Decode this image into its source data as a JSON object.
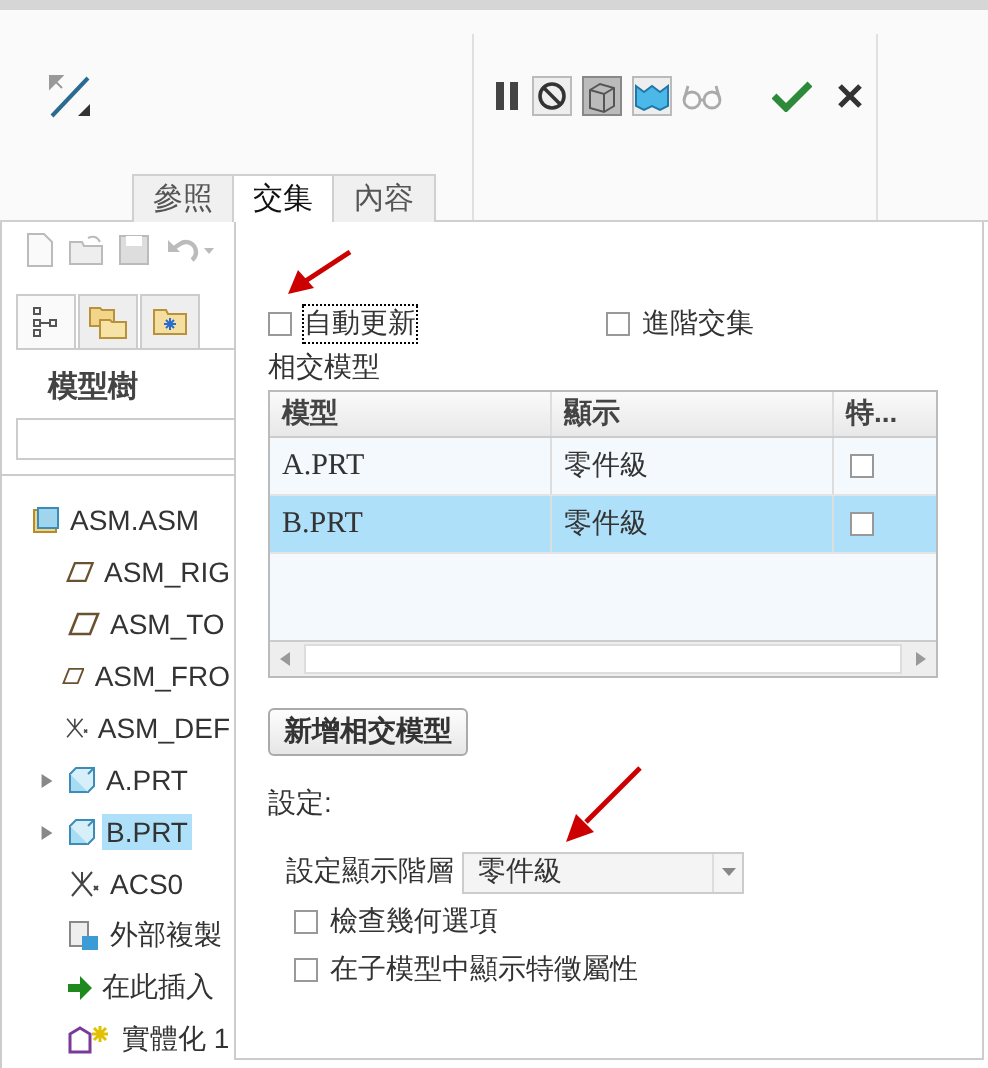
{
  "ribbon": {
    "tabs": [
      {
        "label": "參照",
        "selected": false
      },
      {
        "label": "交集",
        "selected": true
      },
      {
        "label": "內容",
        "selected": false
      }
    ]
  },
  "sidebar": {
    "tabs": [
      {
        "kind": "tree",
        "selected": true
      },
      {
        "kind": "folders",
        "selected": false
      },
      {
        "kind": "favorites",
        "selected": false
      }
    ],
    "title": "模型樹",
    "tree": [
      {
        "label": "ASM.ASM",
        "kind": "assembly",
        "selected": false,
        "children": [
          {
            "label": "ASM_RIG",
            "kind": "plane",
            "selected": false
          },
          {
            "label": "ASM_TO",
            "kind": "plane",
            "selected": false
          },
          {
            "label": "ASM_FRO",
            "kind": "plane",
            "selected": false
          },
          {
            "label": "ASM_DEF",
            "kind": "csys",
            "selected": false
          },
          {
            "label": "A.PRT",
            "kind": "part",
            "expanded": false,
            "selected": false
          },
          {
            "label": "B.PRT",
            "kind": "part",
            "expanded": false,
            "selected": true
          },
          {
            "label": "ACS0",
            "kind": "csys",
            "selected": false
          },
          {
            "label": "外部複製",
            "kind": "copy",
            "selected": false
          },
          {
            "label": "在此插入",
            "kind": "insert",
            "selected": false
          },
          {
            "label": "實體化 1",
            "kind": "solidify",
            "selected": false
          }
        ]
      }
    ]
  },
  "panel": {
    "auto_update": {
      "label": "自動更新",
      "checked": false,
      "focused": true
    },
    "advanced": {
      "label": "進階交集",
      "checked": false
    },
    "table_title": "相交模型",
    "table": {
      "columns": [
        "模型",
        "顯示",
        "特..."
      ],
      "rows": [
        {
          "model": "A.PRT",
          "display": "零件級",
          "checked": false,
          "selected": false
        },
        {
          "model": "B.PRT",
          "display": "零件級",
          "checked": false,
          "selected": true
        }
      ]
    },
    "add_button": "新增相交模型",
    "settings_label": "設定:",
    "display_level": {
      "label": "設定顯示階層",
      "value": "零件級"
    },
    "options": [
      {
        "label": "檢查幾何選項",
        "checked": false
      },
      {
        "label": "在子模型中顯示特徵屬性",
        "checked": false
      }
    ]
  }
}
